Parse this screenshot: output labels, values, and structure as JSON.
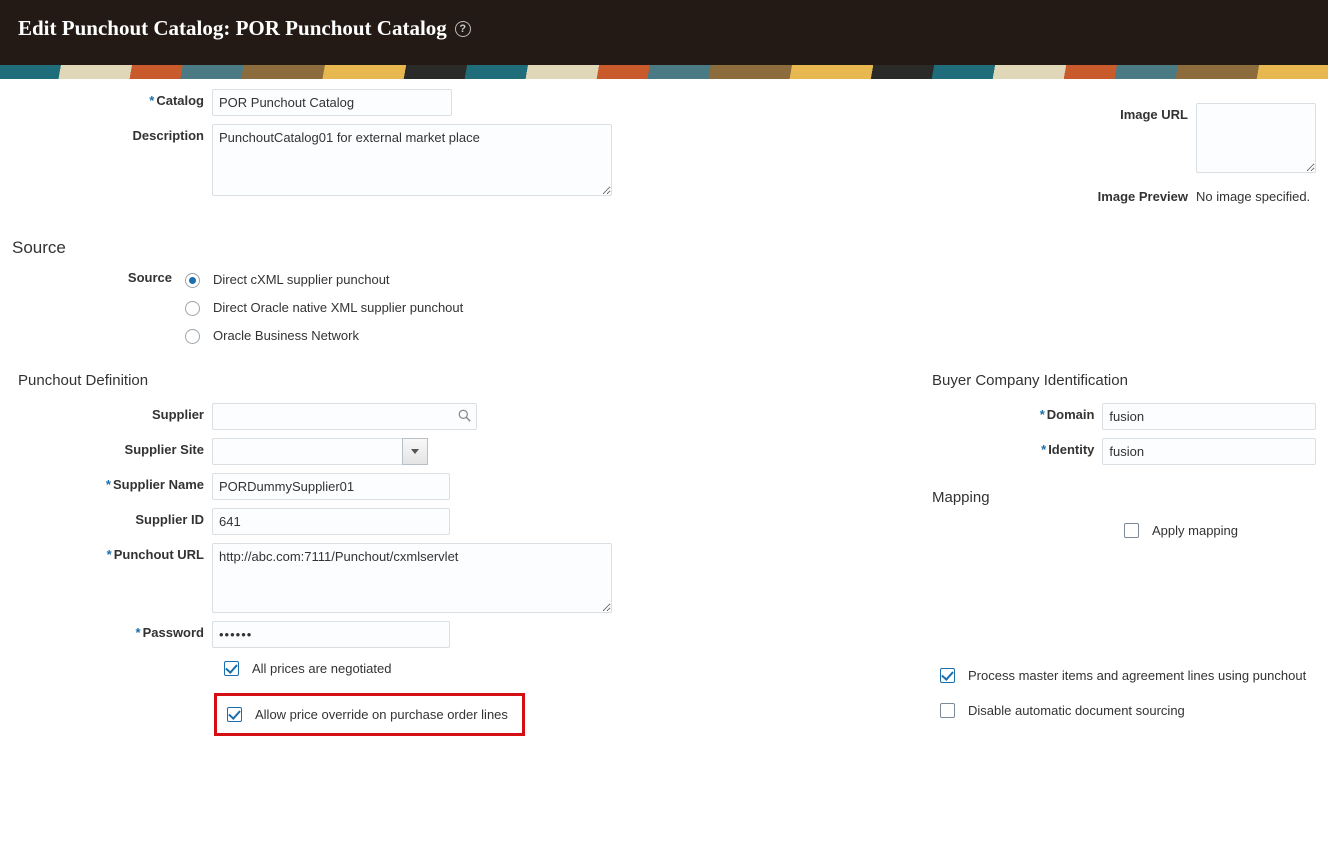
{
  "header": {
    "title": "Edit Punchout Catalog: POR Punchout Catalog"
  },
  "top": {
    "catalog_label": "Catalog",
    "catalog_value": "POR Punchout Catalog",
    "description_label": "Description",
    "description_value": "PunchoutCatalog01 for external market place",
    "image_url_label": "Image URL",
    "image_preview_label": "Image Preview",
    "image_preview_value": "No image specified."
  },
  "source": {
    "section": "Source",
    "label": "Source",
    "options": [
      "Direct cXML supplier punchout",
      "Direct Oracle native XML supplier punchout",
      "Oracle Business Network"
    ]
  },
  "punchout_def": {
    "section": "Punchout Definition",
    "supplier_label": "Supplier",
    "supplier_value": "",
    "supplier_site_label": "Supplier Site",
    "supplier_site_value": "",
    "supplier_name_label": "Supplier Name",
    "supplier_name_value": "PORDummySupplier01",
    "supplier_id_label": "Supplier ID",
    "supplier_id_value": "641",
    "punchout_url_label": "Punchout URL",
    "punchout_url_value": "http://abc.com:7111/Punchout/cxmlservlet",
    "password_label": "Password",
    "password_value": "••••••",
    "all_prices_neg": "All prices are negotiated",
    "allow_price_override": "Allow price override on purchase order lines"
  },
  "buyer": {
    "section": "Buyer Company Identification",
    "domain_label": "Domain",
    "domain_value": "fusion",
    "identity_label": "Identity",
    "identity_value": "fusion"
  },
  "mapping": {
    "section": "Mapping",
    "apply_mapping": "Apply mapping"
  },
  "right_checks": {
    "process_master": "Process master items and agreement lines using punchout",
    "disable_sourcing": "Disable automatic document sourcing"
  }
}
